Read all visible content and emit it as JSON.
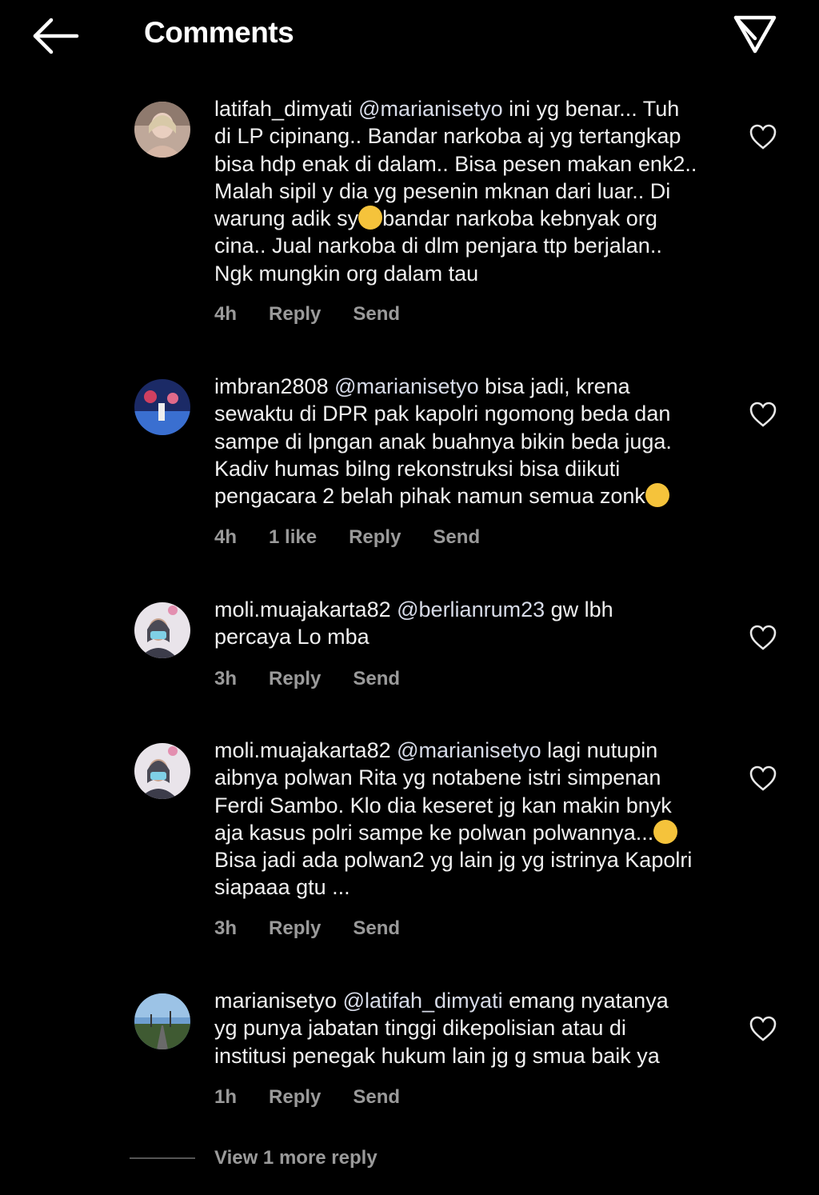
{
  "header": {
    "title": "Comments",
    "back_icon": "arrow-left-icon",
    "share_icon": "paper-plane-icon"
  },
  "comments": [
    {
      "username": "latifah_dimyati",
      "mention": "@marianisetyo",
      "text_lines": [
        " ini yg benar... Tuh",
        "di LP cipinang.. Bandar narkoba aj yg tertangkap",
        "bisa hdp enak di dalam.. Bisa pesen makan enk2..",
        "Malah sipil y dia yg pesenin mknan dari luar.. Di",
        "warung adik sy",
        "bandar narkoba kebnyak org",
        "cina.. Jual narkoba di dlm penjara ttp berjalan..",
        "Ngk mungkin org dalam tau"
      ],
      "time": "4h",
      "likes": "",
      "reply": "Reply",
      "send": "Send"
    },
    {
      "username": "imbran2808",
      "mention": "@marianisetyo",
      "text_lines": [
        " bisa jadi, krena",
        "sewaktu di DPR pak kapolri ngomong beda dan",
        "sampe di lpngan anak buahnya bikin beda juga.",
        "Kadiv humas bilng rekonstruksi bisa diikuti",
        "pengacara 2 belah pihak namun semua zonk"
      ],
      "time": "4h",
      "likes": "1 like",
      "reply": "Reply",
      "send": "Send"
    },
    {
      "username": "moli.muajakarta82",
      "mention": "@berlianrum23",
      "text_lines": [
        " gw lbh",
        "percaya Lo mba"
      ],
      "time": "3h",
      "likes": "",
      "reply": "Reply",
      "send": "Send"
    },
    {
      "username": "moli.muajakarta82",
      "mention": "@marianisetyo",
      "text_lines": [
        " lagi nutupin",
        "aibnya polwan Rita yg notabene istri simpenan",
        "Ferdi Sambo. Klo dia keseret jg kan makin bnyk",
        "aja kasus polri sampe ke polwan polwannya...",
        "Bisa jadi ada polwan2 yg lain jg yg istrinya Kapolri",
        "siapaaa gtu ..."
      ],
      "time": "3h",
      "likes": "",
      "reply": "Reply",
      "send": "Send"
    },
    {
      "username": "marianisetyo",
      "mention": "@latifah_dimyati",
      "text_lines": [
        " emang nyatanya",
        "yg punya jabatan tinggi dikepolisian atau di",
        "institusi penegak hukum lain jg g smua baik ya"
      ],
      "time": "1h",
      "likes": "",
      "reply": "Reply",
      "send": "Send"
    }
  ],
  "view_more": "View 1 more reply",
  "icons": {
    "like": "heart-outline-icon",
    "emoji": "smiley-emoji-icon"
  }
}
